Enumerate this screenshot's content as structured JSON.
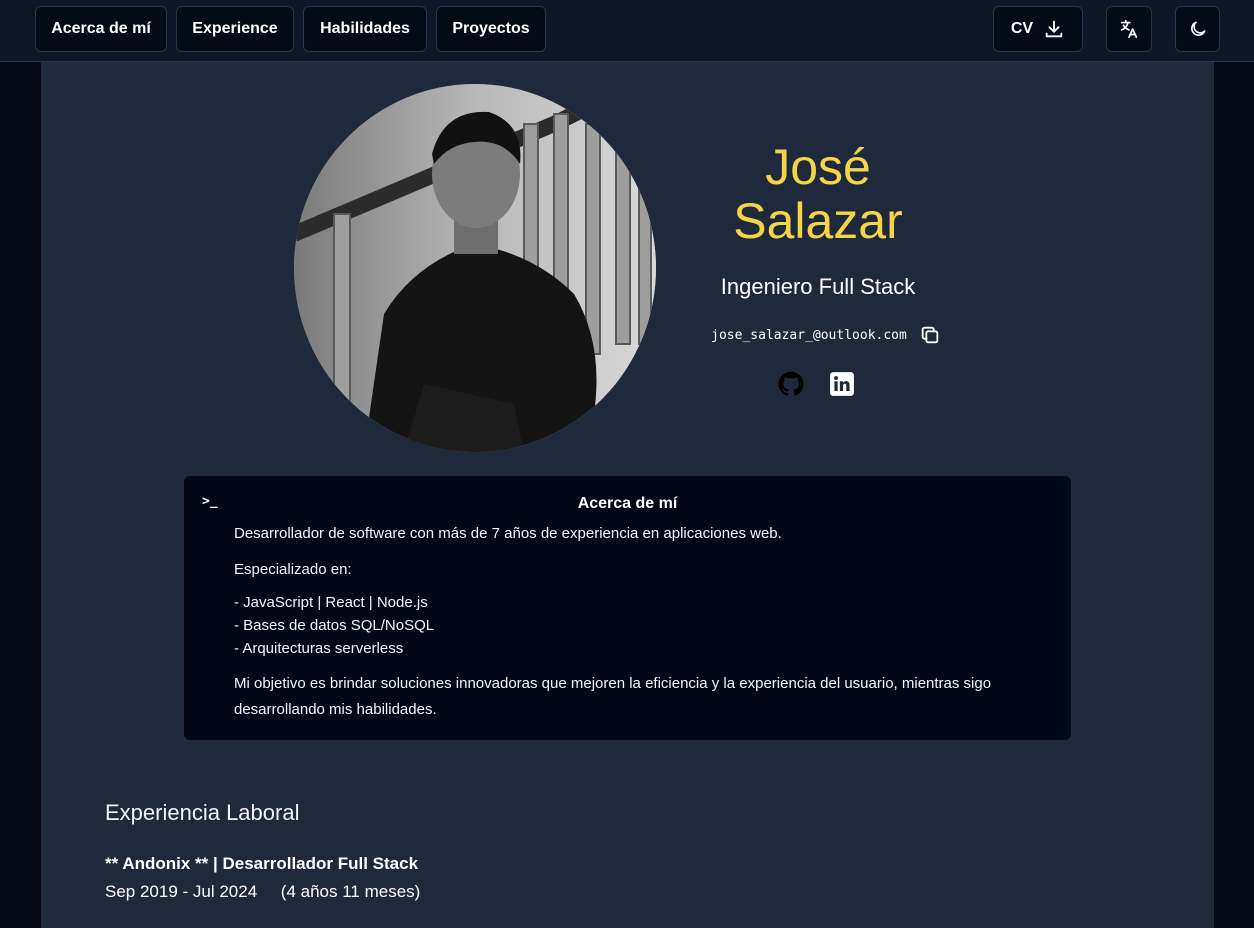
{
  "nav": {
    "items": [
      "Acerca de mí",
      "Experience",
      "Habilidades",
      "Proyectos"
    ],
    "cv_label": "CV",
    "cv_icon": "download-icon",
    "translate_icon": "translate-icon",
    "theme_icon": "moon-icon"
  },
  "profile": {
    "first_name": "José",
    "last_name": "Salazar",
    "role": "Ingeniero Full Stack",
    "email": "jose_salazar_@outlook.com",
    "copy_icon": "copy-icon",
    "socials": [
      "github-icon",
      "linkedin-icon"
    ],
    "name_color": "#f5d547"
  },
  "about": {
    "prompt": ">_",
    "title": "Acerca de mí",
    "intro": "Desarrollador de software con más de 7 años de experiencia en aplicaciones web.",
    "specialized": "Especializado en:",
    "list": [
      "- JavaScript | React | Node.js",
      "- Bases de datos SQL/NoSQL",
      "- Arquitecturas serverless"
    ],
    "objective": "Mi objetivo es brindar soluciones innovadoras que mejoren la eficiencia y la experiencia del usuario, mientras sigo desarrollando mis habilidades."
  },
  "experience": {
    "title": "Experiencia Laboral",
    "job_title": "** Andonix ** | Desarrollador Full Stack",
    "dates": "Sep 2019 - Jul 2024",
    "duration": "(4 años 11 meses)"
  }
}
